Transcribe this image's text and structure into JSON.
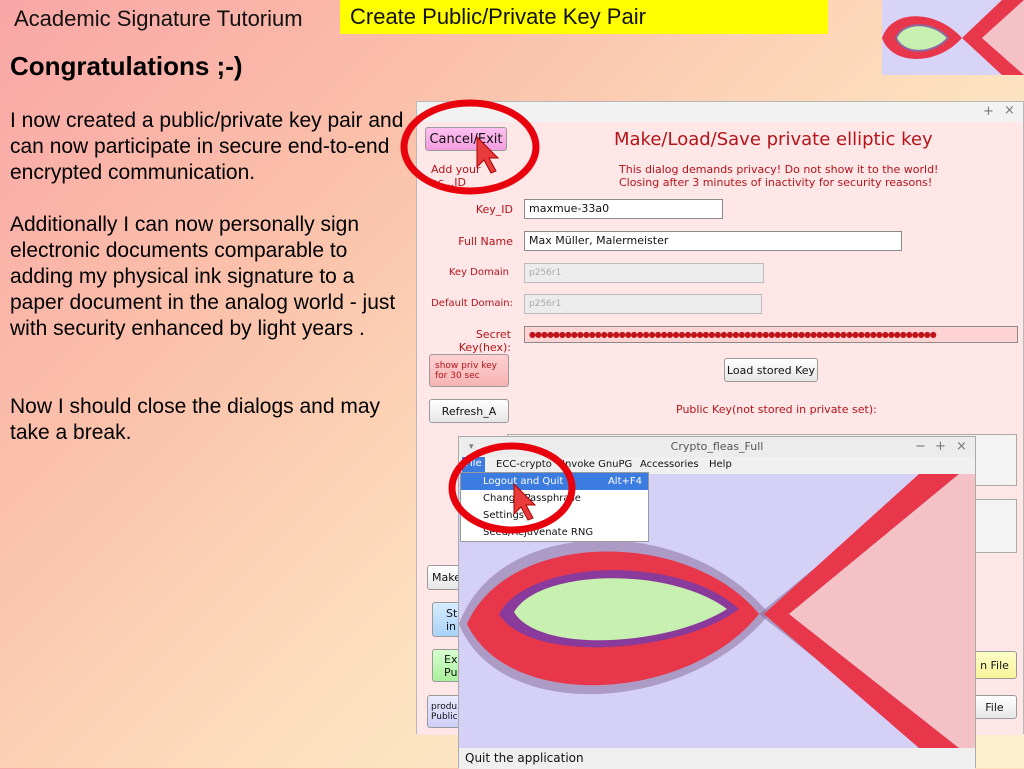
{
  "tutorial": {
    "title": "Academic Signature Tutorium",
    "banner": "Create Public/Private Key Pair",
    "heading": "Congratulations ;-)",
    "paragraphs": [
      "I now created a public/private key pair and can now participate in secure end-to-end encrypted communication.",
      "Additionally I can now personally sign electronic documents comparable to adding my physical ink signature to a paper document in the analog world - just with security enhanced by light years .",
      "Now I should close the dialogs and may take a break."
    ]
  },
  "key_dialog": {
    "title_buttons": [
      "+",
      "×"
    ],
    "cancel_label": "Cancel/Exit",
    "heading": "Make/Load/Save private elliptic key",
    "add_hint": "Add your ac...ID",
    "privacy_line1": "This dialog demands privacy! Do not show it to the world!",
    "privacy_line2": "Closing after 3 minutes of inactivity for security reasons!",
    "key_id_label": "Key_ID",
    "key_id_value": "maxmue-33a0",
    "full_name_label": "Full Name",
    "full_name_value": "Max Müller, Malermeister",
    "key_domain_label": "Key Domain",
    "key_domain_value": "p256r1",
    "default_domain_label": "Default Domain:",
    "default_domain_value": "p256r1",
    "secret_key_label": "Secret Key(hex):",
    "secret_key_mask": "●●●●●●●●●●●●●●●●●●●●●●●●●●●●●●●●●●●●●●●●●●●●●●●●●●●●●●●●●●●●●●●●●●●●",
    "show_priv_label_1": "show priv key",
    "show_priv_label_2": "for 30 sec",
    "load_stored_label": "Load stored Key",
    "refresh_label": "Refresh_A",
    "public_key_label": "Public Key(not stored in private set):",
    "make_label": "Make",
    "store_label_1": "St",
    "store_label_2": "in",
    "export_label_1": "Ex",
    "export_label_2": "Pu",
    "product_label_1": "produ",
    "product_label_2": "Public",
    "file_btn1_label": "n File",
    "file_btn2_label": "File"
  },
  "crypto_window": {
    "title": "Crypto_fleas_Full",
    "title_buttons": [
      "−",
      "+",
      "×"
    ],
    "menu": [
      "File",
      "ECC-crypto",
      "Invoke GnuPG",
      "Accessories",
      "Help"
    ],
    "file_menu": [
      {
        "label": "Logout and Quit",
        "shortcut": "Alt+F4"
      },
      {
        "label": "Change Passphrase",
        "shortcut": ""
      },
      {
        "label": "Settings",
        "shortcut": ""
      },
      {
        "label": "Seed/Rejuvenate RNG",
        "shortcut": ""
      }
    ],
    "status": "Quit the application"
  },
  "colors": {
    "banner": "#ffff00",
    "heading_red": "#b3141a",
    "annotation_red": "#e8000c",
    "menu_highlight": "#3c7be0"
  }
}
